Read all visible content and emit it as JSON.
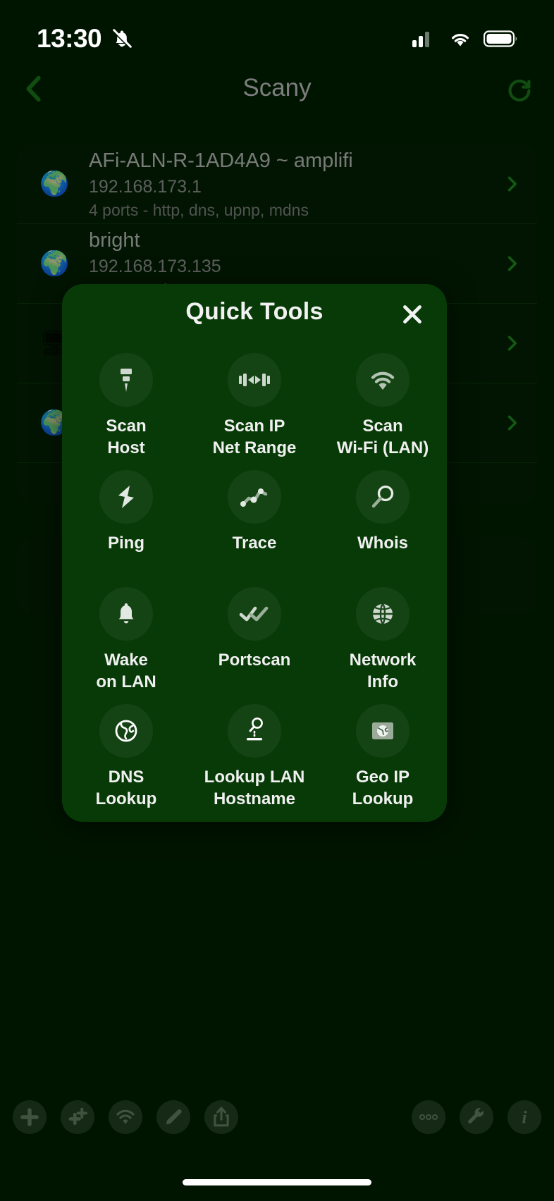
{
  "status_bar": {
    "time": "13:30",
    "icons": [
      "bell-slash-icon",
      "cellular-signal-icon",
      "wifi-icon",
      "battery-icon"
    ]
  },
  "nav": {
    "title": "Scany",
    "back_icon": "chevron-left-icon",
    "refresh_icon": "refresh-icon"
  },
  "host_list": {
    "rows": [
      {
        "icon": "globe-emoji-icon",
        "name": "AFi-ALN-R-1AD4A9 ~ amplifi",
        "ip": "192.168.173.1",
        "ports": "4 ports - http, dns, upnp, mdns"
      },
      {
        "icon": "globe-emoji-icon",
        "name": "bright",
        "ip": "192.168.173.135",
        "ports": "1 port - mdns"
      },
      {
        "icon": "monitor-emoji-icon",
        "name": "",
        "ip": "",
        "ports": ""
      },
      {
        "icon": "globe-emoji-icon",
        "name": "",
        "ip": "",
        "ports": ""
      }
    ]
  },
  "modal": {
    "title": "Quick Tools",
    "close_label": "✕",
    "tools": [
      {
        "label": "Scan\nHost",
        "icon": "scan-host-icon"
      },
      {
        "label": "Scan IP\nNet Range",
        "icon": "ip-range-icon"
      },
      {
        "label": "Scan\nWi-Fi (LAN)",
        "icon": "wifi-icon"
      },
      {
        "label": "Ping",
        "icon": "ping-bolt-icon"
      },
      {
        "label": "Trace",
        "icon": "trace-route-icon"
      },
      {
        "label": "Whois",
        "icon": "magnifier-icon"
      },
      {
        "label": "Wake\non LAN",
        "icon": "bell-icon"
      },
      {
        "label": "Portscan",
        "icon": "double-check-icon"
      },
      {
        "label": "Network\nInfo",
        "icon": "network-globe-icon"
      },
      {
        "label": "DNS\nLookup",
        "icon": "globe-outline-icon"
      },
      {
        "label": "Lookup LAN\nHostname",
        "icon": "hostname-lookup-icon"
      },
      {
        "label": "Geo IP\nLookup",
        "icon": "geo-ip-icon"
      }
    ]
  },
  "toolbar": {
    "left": [
      {
        "name": "add-host-button",
        "icon": "plus-icon"
      },
      {
        "name": "add-multi-button",
        "icon": "plus-plus-icon"
      },
      {
        "name": "wifi-scan-button",
        "icon": "wifi-icon"
      },
      {
        "name": "edit-button",
        "icon": "pencil-icon"
      },
      {
        "name": "share-button",
        "icon": "share-icon"
      }
    ],
    "right": [
      {
        "name": "more-button",
        "icon": "ellipsis-icon"
      },
      {
        "name": "tools-button",
        "icon": "wrench-icon"
      },
      {
        "name": "info-button",
        "icon": "info-icon"
      }
    ]
  },
  "colors": {
    "background": "#001500",
    "modal": "#083a07",
    "accent_green": "#1f6b1f",
    "text_primary": "#f0f0f0",
    "text_dim": "#7d7d7d"
  }
}
